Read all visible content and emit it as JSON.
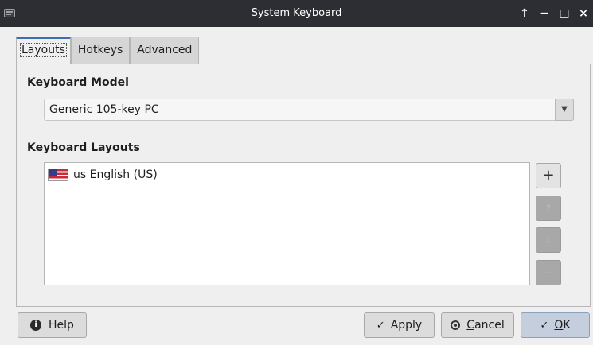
{
  "window": {
    "title": "System Keyboard",
    "controls": {
      "keep_above": "↑",
      "minimize": "−",
      "maximize": "□",
      "close": "×"
    }
  },
  "tabs": [
    {
      "label": "Layouts",
      "active": true
    },
    {
      "label": "Hotkeys",
      "active": false
    },
    {
      "label": "Advanced",
      "active": false
    }
  ],
  "layouts_tab": {
    "keyboard_model": {
      "heading": "Keyboard Model",
      "selected": "Generic 105-key PC",
      "dropdown_arrow": "▼"
    },
    "keyboard_layouts": {
      "heading": "Keyboard Layouts",
      "items": [
        {
          "flag": "us-flag-icon",
          "label": "us English (US)"
        }
      ],
      "buttons": {
        "add": "+",
        "move_up": "↑",
        "move_down": "↓",
        "remove": "−"
      }
    }
  },
  "footer": {
    "help": "Help",
    "apply": "Apply",
    "cancel_prefix": "",
    "cancel_mnemonic": "C",
    "cancel_rest": "ancel",
    "ok_mnemonic": "O",
    "ok_rest": "K",
    "check_glyph": "✓"
  },
  "colors": {
    "titlebar_bg": "#2c2e33",
    "window_bg": "#efefef",
    "active_tab_accent": "#3c6fb4",
    "default_button_bg": "#c5cedc"
  }
}
